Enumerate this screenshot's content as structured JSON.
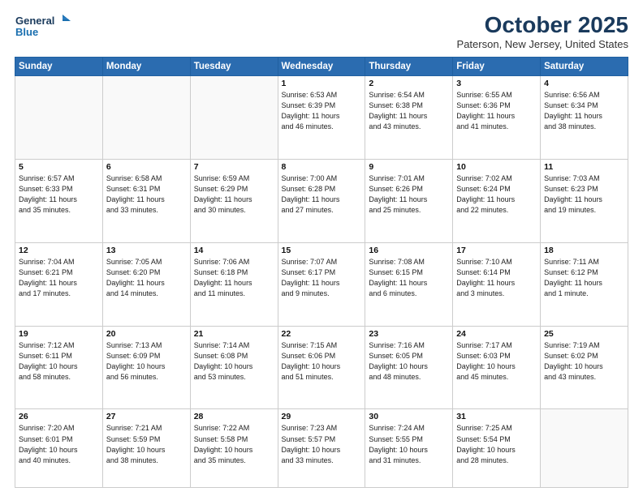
{
  "header": {
    "logo_line1": "General",
    "logo_line2": "Blue",
    "month_year": "October 2025",
    "location": "Paterson, New Jersey, United States"
  },
  "days_of_week": [
    "Sunday",
    "Monday",
    "Tuesday",
    "Wednesday",
    "Thursday",
    "Friday",
    "Saturday"
  ],
  "weeks": [
    [
      {
        "num": "",
        "info": ""
      },
      {
        "num": "",
        "info": ""
      },
      {
        "num": "",
        "info": ""
      },
      {
        "num": "1",
        "info": "Sunrise: 6:53 AM\nSunset: 6:39 PM\nDaylight: 11 hours\nand 46 minutes."
      },
      {
        "num": "2",
        "info": "Sunrise: 6:54 AM\nSunset: 6:38 PM\nDaylight: 11 hours\nand 43 minutes."
      },
      {
        "num": "3",
        "info": "Sunrise: 6:55 AM\nSunset: 6:36 PM\nDaylight: 11 hours\nand 41 minutes."
      },
      {
        "num": "4",
        "info": "Sunrise: 6:56 AM\nSunset: 6:34 PM\nDaylight: 11 hours\nand 38 minutes."
      }
    ],
    [
      {
        "num": "5",
        "info": "Sunrise: 6:57 AM\nSunset: 6:33 PM\nDaylight: 11 hours\nand 35 minutes."
      },
      {
        "num": "6",
        "info": "Sunrise: 6:58 AM\nSunset: 6:31 PM\nDaylight: 11 hours\nand 33 minutes."
      },
      {
        "num": "7",
        "info": "Sunrise: 6:59 AM\nSunset: 6:29 PM\nDaylight: 11 hours\nand 30 minutes."
      },
      {
        "num": "8",
        "info": "Sunrise: 7:00 AM\nSunset: 6:28 PM\nDaylight: 11 hours\nand 27 minutes."
      },
      {
        "num": "9",
        "info": "Sunrise: 7:01 AM\nSunset: 6:26 PM\nDaylight: 11 hours\nand 25 minutes."
      },
      {
        "num": "10",
        "info": "Sunrise: 7:02 AM\nSunset: 6:24 PM\nDaylight: 11 hours\nand 22 minutes."
      },
      {
        "num": "11",
        "info": "Sunrise: 7:03 AM\nSunset: 6:23 PM\nDaylight: 11 hours\nand 19 minutes."
      }
    ],
    [
      {
        "num": "12",
        "info": "Sunrise: 7:04 AM\nSunset: 6:21 PM\nDaylight: 11 hours\nand 17 minutes."
      },
      {
        "num": "13",
        "info": "Sunrise: 7:05 AM\nSunset: 6:20 PM\nDaylight: 11 hours\nand 14 minutes."
      },
      {
        "num": "14",
        "info": "Sunrise: 7:06 AM\nSunset: 6:18 PM\nDaylight: 11 hours\nand 11 minutes."
      },
      {
        "num": "15",
        "info": "Sunrise: 7:07 AM\nSunset: 6:17 PM\nDaylight: 11 hours\nand 9 minutes."
      },
      {
        "num": "16",
        "info": "Sunrise: 7:08 AM\nSunset: 6:15 PM\nDaylight: 11 hours\nand 6 minutes."
      },
      {
        "num": "17",
        "info": "Sunrise: 7:10 AM\nSunset: 6:14 PM\nDaylight: 11 hours\nand 3 minutes."
      },
      {
        "num": "18",
        "info": "Sunrise: 7:11 AM\nSunset: 6:12 PM\nDaylight: 11 hours\nand 1 minute."
      }
    ],
    [
      {
        "num": "19",
        "info": "Sunrise: 7:12 AM\nSunset: 6:11 PM\nDaylight: 10 hours\nand 58 minutes."
      },
      {
        "num": "20",
        "info": "Sunrise: 7:13 AM\nSunset: 6:09 PM\nDaylight: 10 hours\nand 56 minutes."
      },
      {
        "num": "21",
        "info": "Sunrise: 7:14 AM\nSunset: 6:08 PM\nDaylight: 10 hours\nand 53 minutes."
      },
      {
        "num": "22",
        "info": "Sunrise: 7:15 AM\nSunset: 6:06 PM\nDaylight: 10 hours\nand 51 minutes."
      },
      {
        "num": "23",
        "info": "Sunrise: 7:16 AM\nSunset: 6:05 PM\nDaylight: 10 hours\nand 48 minutes."
      },
      {
        "num": "24",
        "info": "Sunrise: 7:17 AM\nSunset: 6:03 PM\nDaylight: 10 hours\nand 45 minutes."
      },
      {
        "num": "25",
        "info": "Sunrise: 7:19 AM\nSunset: 6:02 PM\nDaylight: 10 hours\nand 43 minutes."
      }
    ],
    [
      {
        "num": "26",
        "info": "Sunrise: 7:20 AM\nSunset: 6:01 PM\nDaylight: 10 hours\nand 40 minutes."
      },
      {
        "num": "27",
        "info": "Sunrise: 7:21 AM\nSunset: 5:59 PM\nDaylight: 10 hours\nand 38 minutes."
      },
      {
        "num": "28",
        "info": "Sunrise: 7:22 AM\nSunset: 5:58 PM\nDaylight: 10 hours\nand 35 minutes."
      },
      {
        "num": "29",
        "info": "Sunrise: 7:23 AM\nSunset: 5:57 PM\nDaylight: 10 hours\nand 33 minutes."
      },
      {
        "num": "30",
        "info": "Sunrise: 7:24 AM\nSunset: 5:55 PM\nDaylight: 10 hours\nand 31 minutes."
      },
      {
        "num": "31",
        "info": "Sunrise: 7:25 AM\nSunset: 5:54 PM\nDaylight: 10 hours\nand 28 minutes."
      },
      {
        "num": "",
        "info": ""
      }
    ]
  ]
}
